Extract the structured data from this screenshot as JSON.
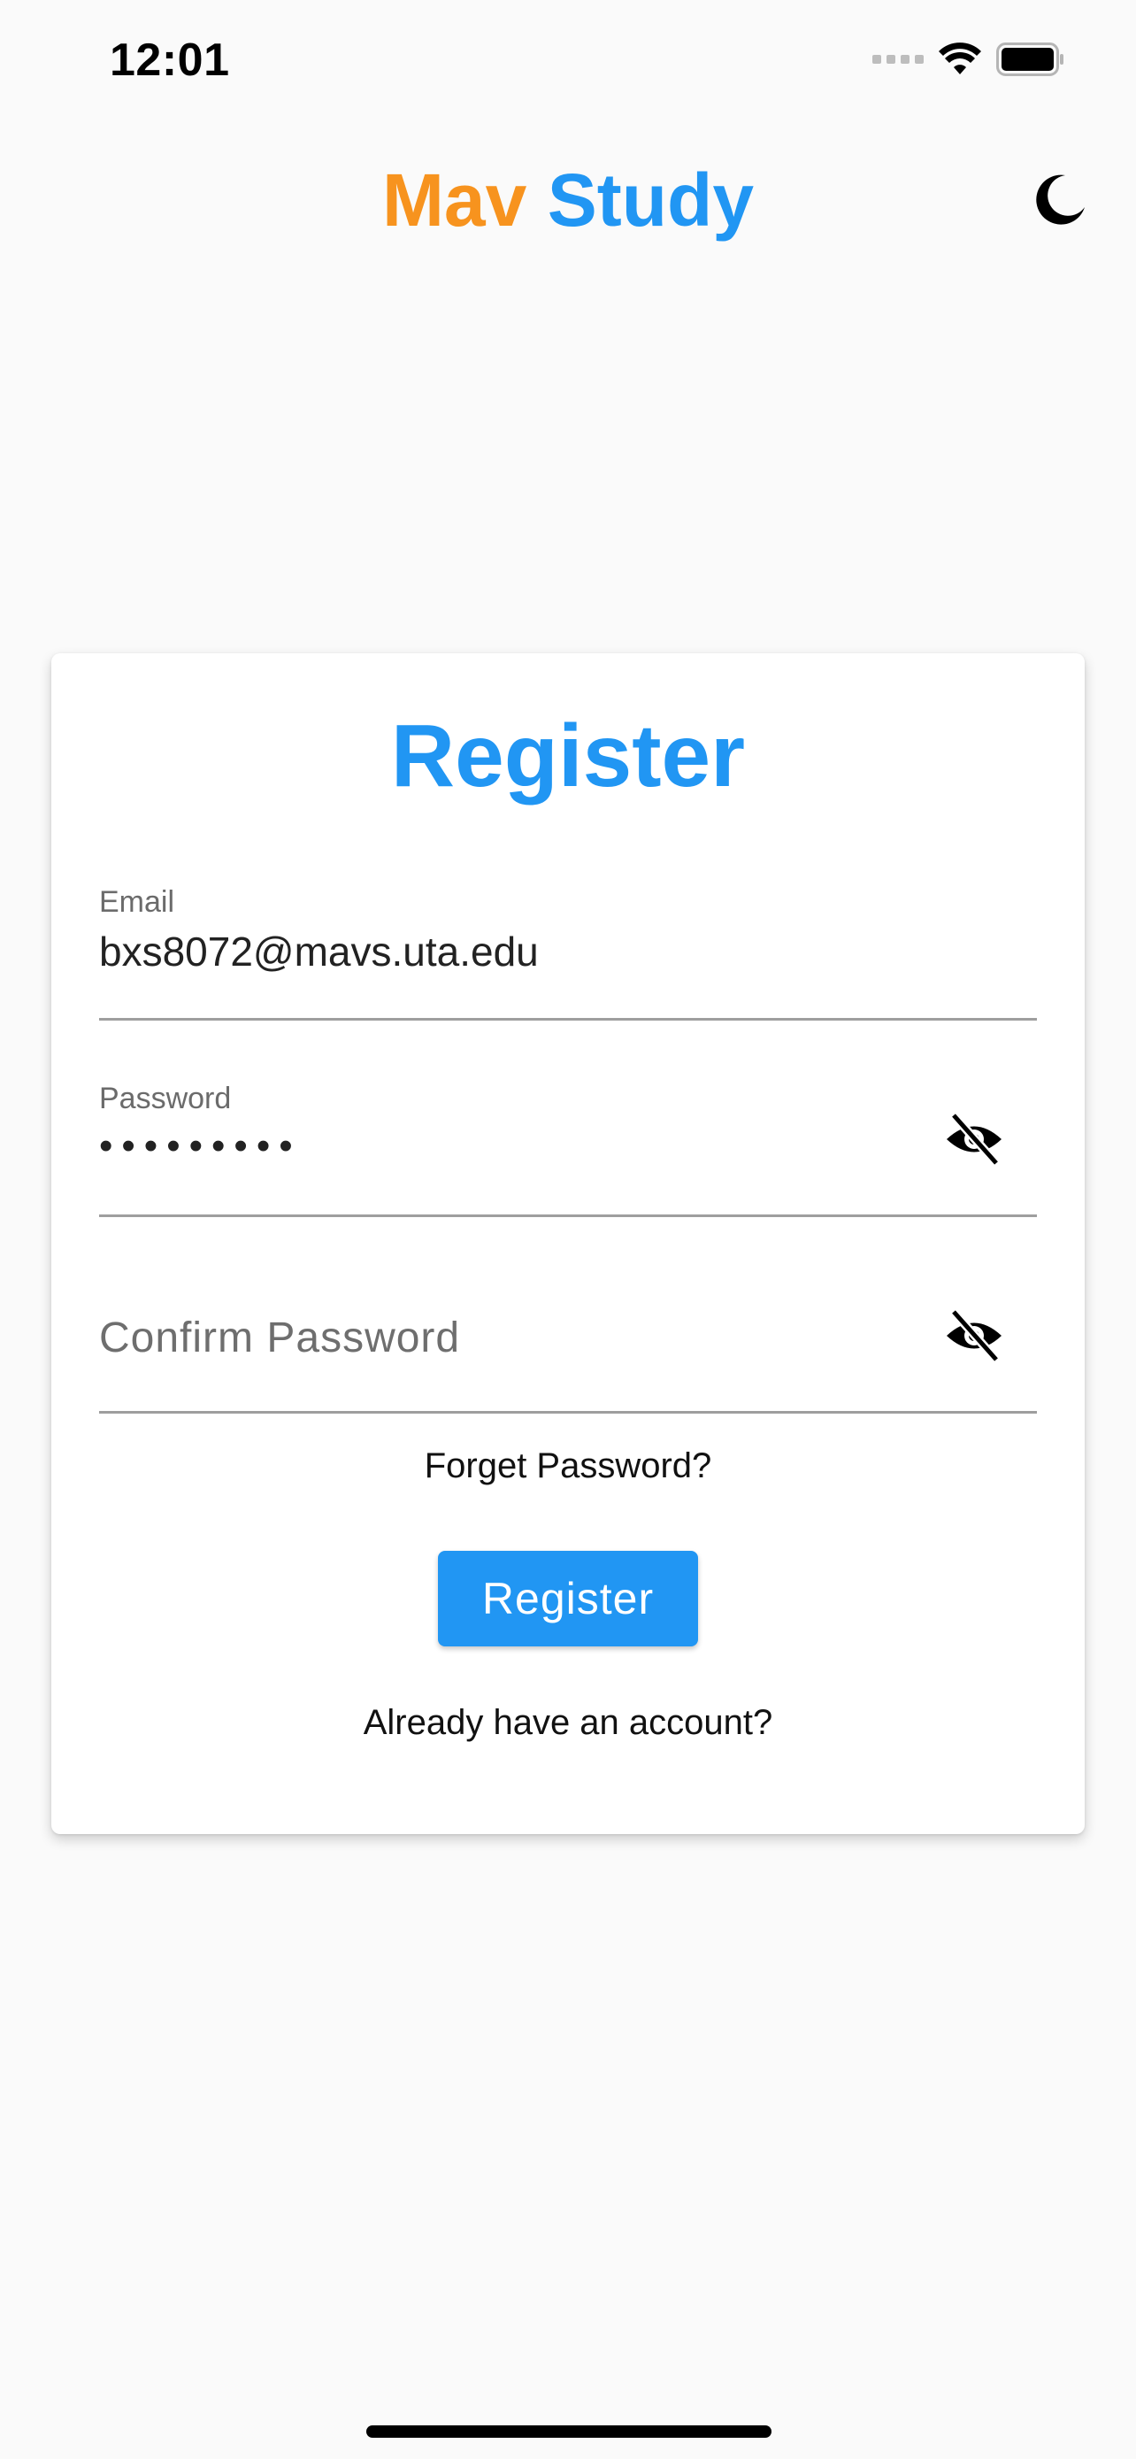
{
  "status_bar": {
    "time": "12:01",
    "icons": [
      "cellular-signal-icon",
      "wifi-icon",
      "battery-icon"
    ]
  },
  "header": {
    "title_part1": "Mav",
    "title_part2": "Study",
    "title_colors": {
      "mav": "#f7931e",
      "study": "#2196f3"
    },
    "theme_toggle_icon": "moon-icon"
  },
  "register_card": {
    "title": "Register",
    "email": {
      "label": "Email",
      "value": "bxs8072@mavs.uta.edu"
    },
    "password": {
      "label": "Password",
      "value": "•••••••••",
      "toggle_icon": "eye-off-icon"
    },
    "confirm_password": {
      "placeholder": "Confirm Password",
      "value": "",
      "toggle_icon": "eye-off-icon"
    },
    "forget_password_link": "Forget Password?",
    "register_button": "Register",
    "login_link": "Already have an account?"
  },
  "colors": {
    "accent": "#2196f3",
    "brand_orange": "#f7931e",
    "background": "#fafafa"
  }
}
